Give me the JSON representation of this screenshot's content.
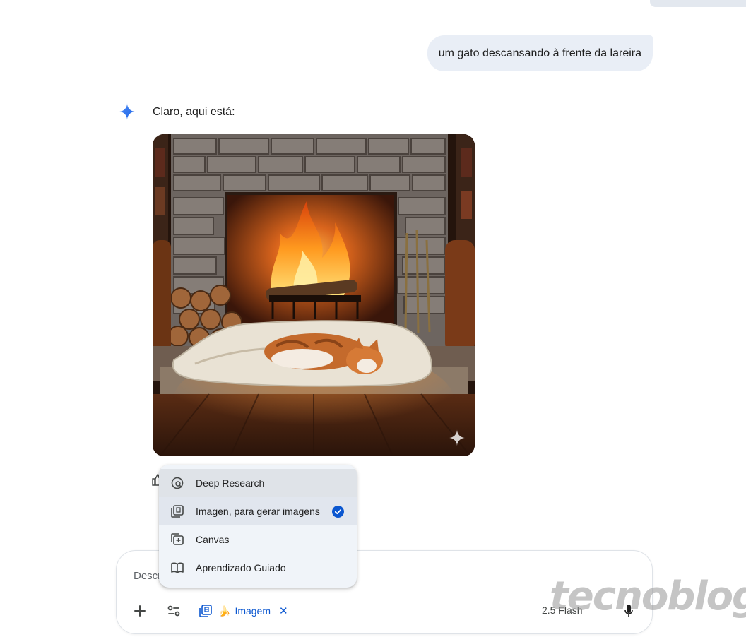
{
  "conversation": {
    "user_message": "um gato descansando à frente da lareira",
    "reply_text": "Claro, aqui está:",
    "image_subject": "gato dormindo em um cobertor em frente à lareira"
  },
  "tools_menu": {
    "items": [
      {
        "label": "Deep Research",
        "icon": "deep-research-icon",
        "selected": false
      },
      {
        "label": "Imagen, para gerar imagens",
        "icon": "image-gen-icon",
        "selected": true
      },
      {
        "label": "Canvas",
        "icon": "canvas-icon",
        "selected": false
      },
      {
        "label": "Aprendizado Guiado",
        "icon": "book-icon",
        "selected": false
      }
    ]
  },
  "composer": {
    "placeholder": "Descreva sua imagem",
    "active_tool_chip": "Imagem",
    "chip_emoji": "🍌",
    "model_label": "2.5 Flash",
    "close_symbol": "✕"
  },
  "watermark": "tecnoblog",
  "colors": {
    "accent_blue": "#0b57d0",
    "bubble_bg": "#e9eef6",
    "menu_bg": "#f0f4f9",
    "check_blue": "#0b57d0"
  }
}
